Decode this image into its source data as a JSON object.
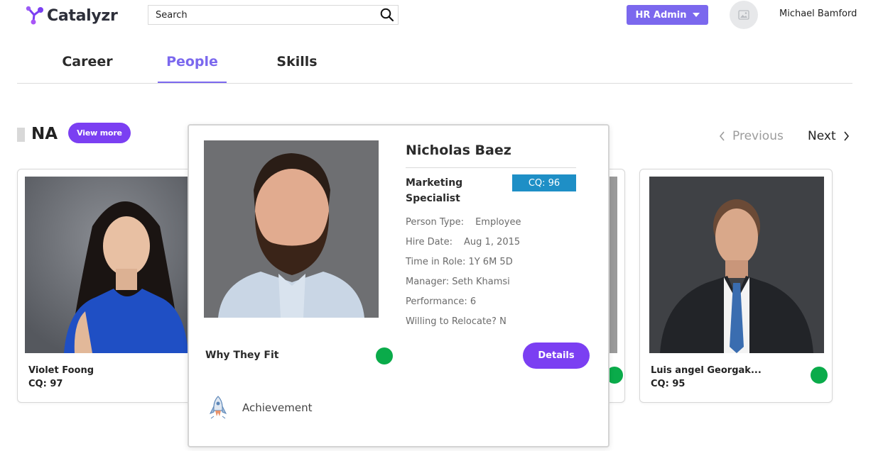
{
  "app": {
    "name": "Catalyzr"
  },
  "header": {
    "search_placeholder": "Search",
    "role_button": "HR Admin",
    "user_name": "Michael Bamford"
  },
  "tabs": [
    {
      "label": "Career",
      "active": false
    },
    {
      "label": "People",
      "active": true
    },
    {
      "label": "Skills",
      "active": false
    }
  ],
  "section": {
    "title": "NA",
    "view_more": "View more",
    "prev_label": "Previous",
    "next_label": "Next"
  },
  "cards": [
    {
      "name": "Violet Foong",
      "cq": "CQ: 97"
    },
    {
      "name": "Luis angel Georgak...",
      "cq": "CQ: 95"
    }
  ],
  "popup": {
    "name": "Nicholas Baez",
    "title": "Marketing Specialist",
    "cq_badge": "CQ: 96",
    "person_type_label": "Person Type:",
    "person_type_value": "Employee",
    "hire_date_label": "Hire Date:",
    "hire_date_value": "Aug 1, 2015",
    "time_in_role": "Time in Role: 1Y 6M 5D",
    "manager": "Manager: Seth Khamsi",
    "performance": "Performance: 6",
    "relocate": "Willing to Relocate? N",
    "why_label": "Why They Fit",
    "details_button": "Details",
    "achievement_label": "Achievement"
  },
  "colors": {
    "accent": "#7b68ee",
    "button_purple": "#7b3ff2",
    "cq_badge": "#1e8fc6",
    "status_green": "#0aab4a"
  },
  "icons": [
    "logo-mark-icon",
    "search-icon",
    "chevron-down-icon",
    "image-placeholder-icon",
    "chevron-left-icon",
    "chevron-right-icon",
    "rocket-icon"
  ]
}
